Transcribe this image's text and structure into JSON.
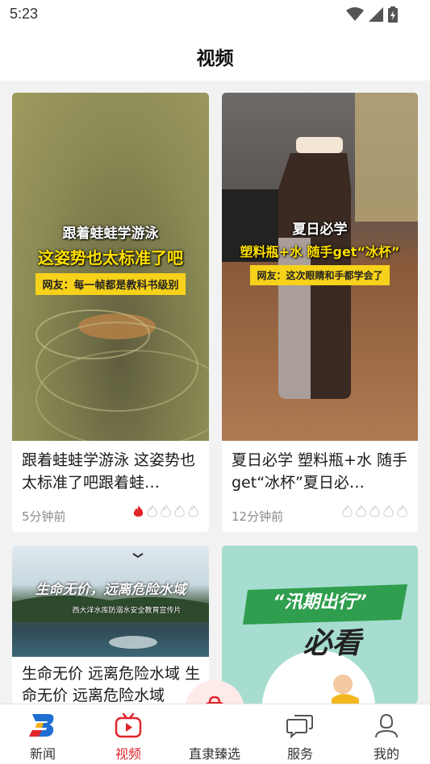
{
  "status": {
    "time": "5:23"
  },
  "header": {
    "title": "视频"
  },
  "cards": [
    {
      "title": "跟着蛙蛙学游泳  这姿势也太标准了吧跟着蛙…",
      "time": "5分钟前",
      "heat": 1,
      "overlay": {
        "line1": "跟着蛙蛙学游泳",
        "line2": "这姿势也太标准了吧",
        "box": "网友：每一帧都是教科书级别"
      }
    },
    {
      "title": "夏日必学  塑料瓶+水  随手get“冰杯”夏日必…",
      "time": "12分钟前",
      "heat": 0,
      "overlay": {
        "line1": "夏日必学",
        "line2": "塑料瓶+水 随手get“冰杯”",
        "box": "网友：这次眼睛和手都学会了"
      }
    },
    {
      "title": "生命无价  远离危险水域 生命无价  远离危险水域",
      "overlay": {
        "line1": "生命无价，远离危险水域",
        "line2": "西大洋水库防溺水安全教育宣传片"
      }
    },
    {
      "overlay": {
        "line1": "“汛期出行”",
        "line2": "必看"
      }
    }
  ],
  "tabbar": {
    "items": [
      {
        "label": "新闻"
      },
      {
        "label": "视频"
      },
      {
        "label": "直隶臻选"
      },
      {
        "label": "服务"
      },
      {
        "label": "我的"
      }
    ]
  },
  "colors": {
    "accent": "#e0262b",
    "text": "#1a1a1a",
    "muted": "#8a8a8a",
    "background": "#f2f2f2"
  }
}
